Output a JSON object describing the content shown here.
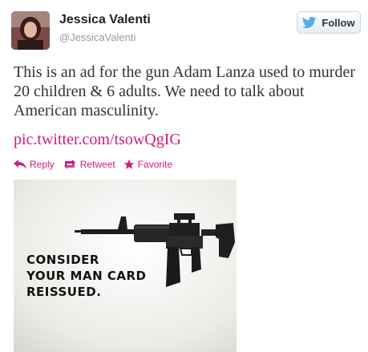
{
  "author": {
    "name": "Jessica Valenti",
    "handle": "@JessicaValenti"
  },
  "follow_button": {
    "label": "Follow",
    "icon": "twitter-bird-icon"
  },
  "tweet": {
    "text": "This is an ad for the gun Adam Lanza used to murder 20 children & 6 adults. We need to talk about American masculinity.",
    "link": "pic.twitter.com/tsowQgIG"
  },
  "actions": [
    {
      "label": "Reply",
      "icon": "reply-icon"
    },
    {
      "label": "Retweet",
      "icon": "retweet-icon"
    },
    {
      "label": "Favorite",
      "icon": "star-icon"
    }
  ],
  "ad": {
    "lines": [
      "CONSIDER",
      "YOUR MAN CARD",
      "REISSUED."
    ]
  },
  "colors": {
    "link": "#cc1b80",
    "name": "#222222",
    "handle": "#999999",
    "twitter_blue": "#55acee"
  }
}
